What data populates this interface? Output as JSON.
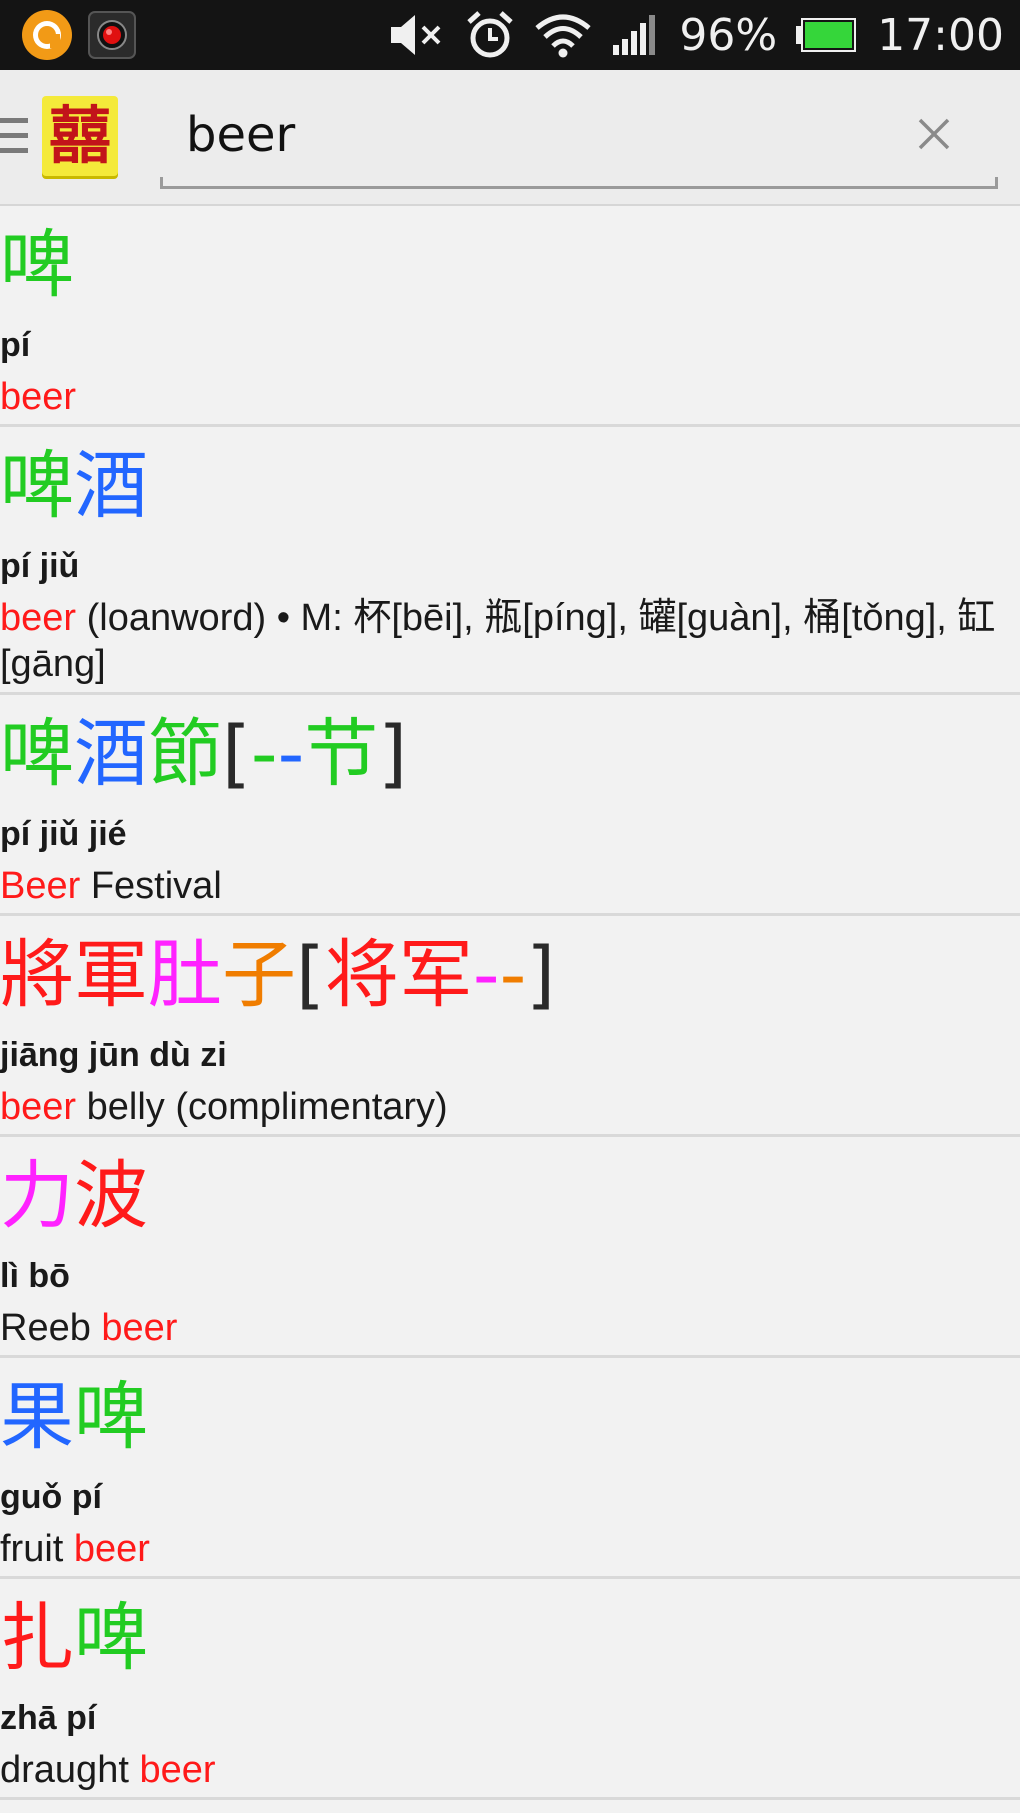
{
  "statusbar": {
    "battery": "96%",
    "time": "17:00"
  },
  "search": {
    "query": "beer",
    "logo_char": "囍"
  },
  "colors": {
    "tone1": "#ff1a1a",
    "tone2": "#f07d00",
    "tone3": "#22cc22",
    "tone4": "#2266ff",
    "tone5": "#ff22ff",
    "neutral": "#2a2a2a"
  },
  "results": [
    {
      "hanzi": [
        {
          "t": "啤",
          "c": "#22cc22"
        }
      ],
      "pinyin": "pí",
      "def": [
        {
          "t": "beer",
          "hl": true
        }
      ]
    },
    {
      "hanzi": [
        {
          "t": "啤",
          "c": "#22cc22"
        },
        {
          "t": "酒",
          "c": "#2266ff"
        }
      ],
      "pinyin": "pí jiǔ",
      "def": [
        {
          "t": "beer",
          "hl": true
        },
        {
          "t": " (loanword) • M: 杯[bēi], 瓶[píng], 罐[guàn], 桶[tǒng], 缸[gāng]",
          "hl": false
        }
      ]
    },
    {
      "hanzi": [
        {
          "t": "啤",
          "c": "#22cc22"
        },
        {
          "t": "酒",
          "c": "#2266ff"
        },
        {
          "t": "節",
          "c": "#22cc22"
        },
        {
          "t": "[",
          "c": "#2a2a2a"
        },
        {
          "t": "-",
          "c": "#22cc22"
        },
        {
          "t": "-",
          "c": "#2266ff"
        },
        {
          "t": "节",
          "c": "#22cc22"
        },
        {
          "t": "]",
          "c": "#2a2a2a"
        }
      ],
      "pinyin": "pí jiǔ jié",
      "def": [
        {
          "t": "Beer",
          "hl": true
        },
        {
          "t": " Festival",
          "hl": false
        }
      ]
    },
    {
      "hanzi": [
        {
          "t": "將",
          "c": "#ff1a1a"
        },
        {
          "t": "軍",
          "c": "#ff1a1a"
        },
        {
          "t": "肚",
          "c": "#ff22ff"
        },
        {
          "t": "子",
          "c": "#f07d00"
        },
        {
          "t": "[",
          "c": "#2a2a2a"
        },
        {
          "t": "将",
          "c": "#ff1a1a"
        },
        {
          "t": "军",
          "c": "#ff1a1a"
        },
        {
          "t": "-",
          "c": "#ff22ff"
        },
        {
          "t": "-",
          "c": "#f07d00"
        },
        {
          "t": "]",
          "c": "#2a2a2a"
        }
      ],
      "pinyin": "jiāng jūn dù zi",
      "def": [
        {
          "t": "beer",
          "hl": true
        },
        {
          "t": " belly (complimentary)",
          "hl": false
        }
      ]
    },
    {
      "hanzi": [
        {
          "t": "力",
          "c": "#ff22ff"
        },
        {
          "t": "波",
          "c": "#ff1a1a"
        }
      ],
      "pinyin": "lì bō",
      "def": [
        {
          "t": "Reeb ",
          "hl": false
        },
        {
          "t": "beer",
          "hl": true
        }
      ]
    },
    {
      "hanzi": [
        {
          "t": "果",
          "c": "#2266ff"
        },
        {
          "t": "啤",
          "c": "#22cc22"
        }
      ],
      "pinyin": "guǒ pí",
      "def": [
        {
          "t": "fruit ",
          "hl": false
        },
        {
          "t": "beer",
          "hl": true
        }
      ]
    },
    {
      "hanzi": [
        {
          "t": "扎",
          "c": "#ff1a1a"
        },
        {
          "t": "啤",
          "c": "#22cc22"
        }
      ],
      "pinyin": "zhā pí",
      "def": [
        {
          "t": "draught ",
          "hl": false
        },
        {
          "t": "beer",
          "hl": true
        }
      ]
    }
  ]
}
